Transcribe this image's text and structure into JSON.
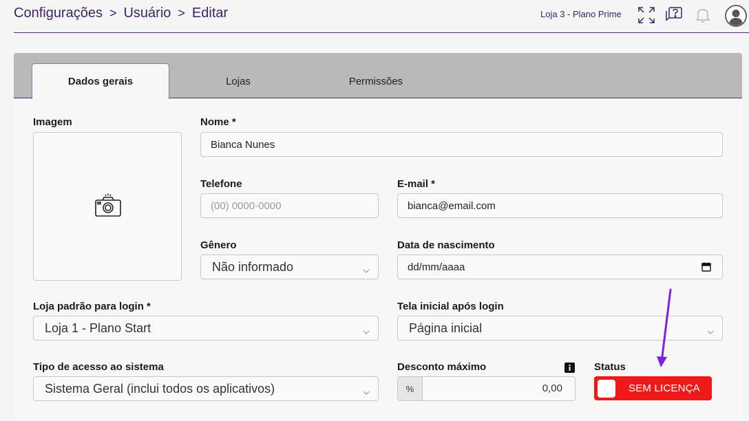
{
  "breadcrumb": {
    "items": [
      "Configurações",
      "Usuário",
      "Editar"
    ],
    "separator": ">"
  },
  "header": {
    "store_plan": "Loja 3 - Plano Prime",
    "icons": [
      "fullscreen-icon",
      "help-chat-icon",
      "notification-bell-icon",
      "user-avatar-icon"
    ]
  },
  "tabs": [
    {
      "label": "Dados gerais",
      "active": true
    },
    {
      "label": "Lojas",
      "active": false
    },
    {
      "label": "Permissões",
      "active": false
    }
  ],
  "form": {
    "image_label": "Imagem",
    "name_label": "Nome *",
    "name_value": "Bianca Nunes",
    "phone_label": "Telefone",
    "phone_placeholder": "(00) 0000-0000",
    "email_label": "E-mail *",
    "email_value": "bianca@email.com",
    "gender_label": "Gênero",
    "gender_value": "Não informado",
    "birthdate_label": "Data de nascimento",
    "birthdate_placeholder": "dd/mm/aaaa",
    "default_store_label": "Loja padrão para login *",
    "default_store_value": "Loja 1 - Plano Start",
    "home_screen_label": "Tela inicial após login",
    "home_screen_value": "Página inicial",
    "access_type_label": "Tipo de acesso ao sistema",
    "access_type_value": "Sistema Geral (inclui todos os aplicativos)",
    "max_discount_label": "Desconto máximo",
    "max_discount_prefix": "%",
    "max_discount_value": "0,00",
    "status_label": "Status",
    "status_value": "SEM LICENÇA"
  },
  "colors": {
    "brand": "#3b2566",
    "status_red": "#ee1a1a",
    "annotation_arrow": "#7b22e0"
  }
}
